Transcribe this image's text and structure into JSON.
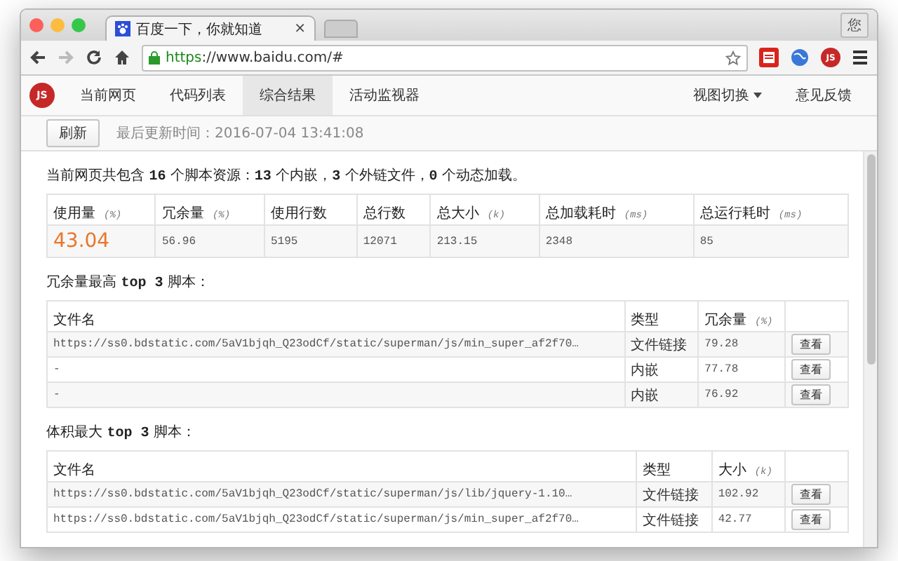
{
  "window": {
    "tab": {
      "title": "百度一下，你就知道",
      "close": "×"
    },
    "profile": "您",
    "address": {
      "scheme": "https",
      "rest": "://www.baidu.com/#"
    },
    "extension_badge": "JS"
  },
  "toolbar": {
    "logo": "JS",
    "tabs": [
      {
        "label": "当前网页",
        "selected": false
      },
      {
        "label": "代码列表",
        "selected": false
      },
      {
        "label": "综合结果",
        "selected": true
      },
      {
        "label": "活动监视器",
        "selected": false
      }
    ],
    "view_menu": "视图切换",
    "feedback": "意见反馈"
  },
  "refresh_button": "刷新",
  "updated": "最后更新时间：2016-07-04 13:41:08",
  "summary": "当前网页共包含 **16** 个脚本资源：**13** 个内嵌，**3** 个外链文件，**0** 个动态加载。",
  "stats": {
    "columns": [
      {
        "name": "使用量",
        "unit": "(%)"
      },
      {
        "name": "冗余量",
        "unit": "(%)"
      },
      {
        "name": "使用行数"
      },
      {
        "name": "总行数"
      },
      {
        "name": "总大小",
        "unit": "(k)"
      },
      {
        "name": "总加载耗时",
        "unit": "(ms)"
      },
      {
        "name": "总运行耗时",
        "unit": "(ms)"
      }
    ],
    "values": [
      {
        "text": "43.04",
        "highlight": true
      },
      {
        "text": "56.96",
        "highlight": false
      },
      {
        "text": "5195",
        "highlight": false
      },
      {
        "text": "12071",
        "highlight": false
      },
      {
        "text": "213.15",
        "highlight": false
      },
      {
        "text": "2348",
        "highlight": false
      },
      {
        "text": "85",
        "highlight": false
      }
    ]
  },
  "sections": [
    {
      "title": "冗余量最高 **top 3** 脚本：",
      "columns": [
        {
          "name": "文件名"
        },
        {
          "name": "类型"
        },
        {
          "name": "冗余量",
          "unit": "(%)"
        }
      ],
      "rows": [
        {
          "file": "https://ss0.bdstatic.com/5aV1bjqh_Q23odCf/static/superman/js/min_super_af2f70…",
          "type": "文件链接",
          "value": "79.28",
          "action": "查看"
        },
        {
          "file": "-",
          "type": "内嵌",
          "value": "77.78",
          "action": "查看"
        },
        {
          "file": "-",
          "type": "内嵌",
          "value": "76.92",
          "action": "查看"
        }
      ]
    },
    {
      "title": "体积最大 **top 3** 脚本：",
      "columns": [
        {
          "name": "文件名"
        },
        {
          "name": "类型"
        },
        {
          "name": "大小",
          "unit": "(k)"
        }
      ],
      "rows": [
        {
          "file": "https://ss0.bdstatic.com/5aV1bjqh_Q23odCf/static/superman/js/lib/jquery-1.10…",
          "type": "文件链接",
          "value": "102.92",
          "action": "查看"
        },
        {
          "file": "https://ss0.bdstatic.com/5aV1bjqh_Q23odCf/static/superman/js/min_super_af2f70…",
          "type": "文件链接",
          "value": "42.77",
          "action": "查看"
        }
      ]
    }
  ]
}
